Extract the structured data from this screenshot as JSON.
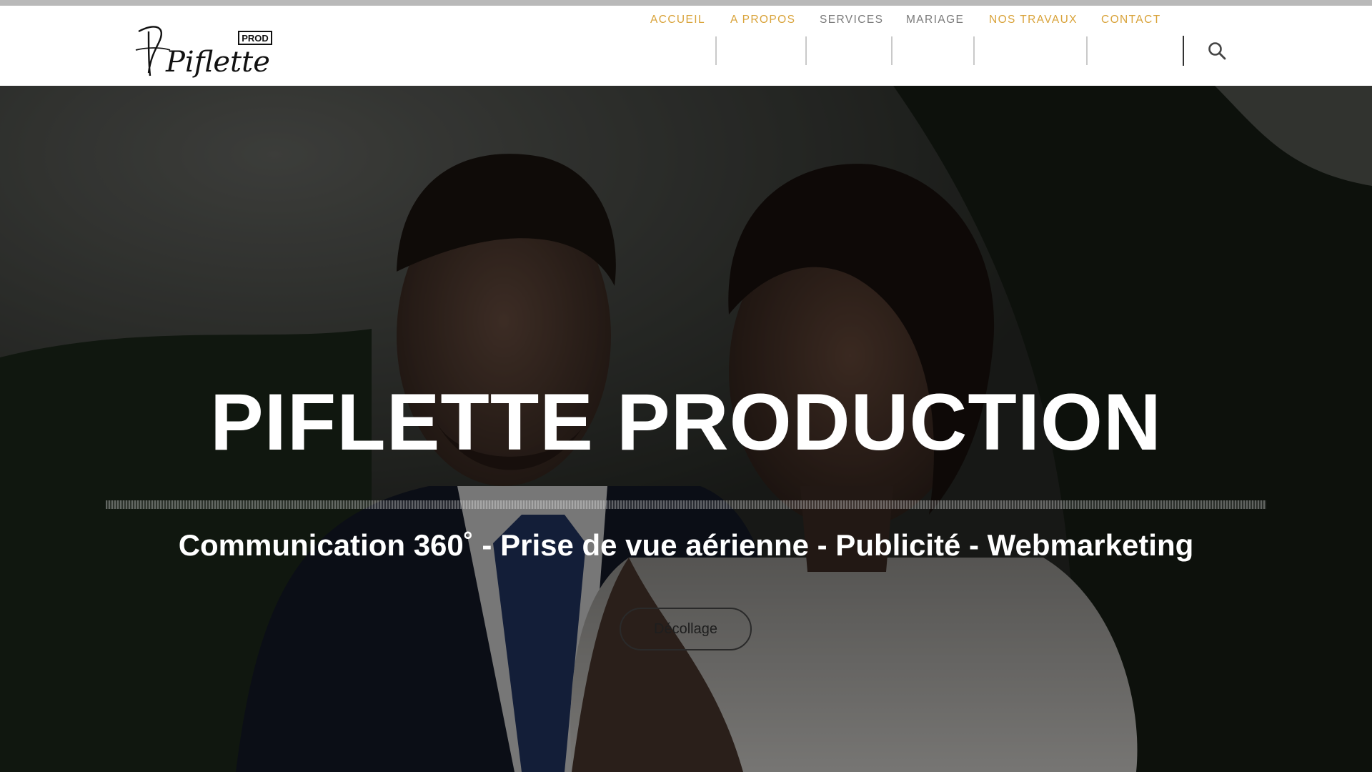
{
  "colors": {
    "nav_active": "#d9a33a",
    "nav_inactive": "#7a7a7a",
    "header_bg": "#ffffff",
    "hero_text": "#ffffff"
  },
  "header": {
    "logo_text": "Piflette",
    "logo_badge": "PROD"
  },
  "nav": {
    "items": [
      {
        "label": "ACCUEIL",
        "state": "highlight"
      },
      {
        "label": "A PROPOS",
        "state": "highlight"
      },
      {
        "label": "SERVICES",
        "state": "normal"
      },
      {
        "label": "MARIAGE",
        "state": "normal"
      },
      {
        "label": "NOS TRAVAUX",
        "state": "highlight"
      },
      {
        "label": "CONTACT",
        "state": "highlight"
      }
    ],
    "search_icon": "search-icon"
  },
  "hero": {
    "title": "PIFLETTE PRODUCTION",
    "subtitle": "Communication 360˚ - Prise de vue aérienne - Publicité - Webmarketing",
    "button_label": "Décollage"
  }
}
